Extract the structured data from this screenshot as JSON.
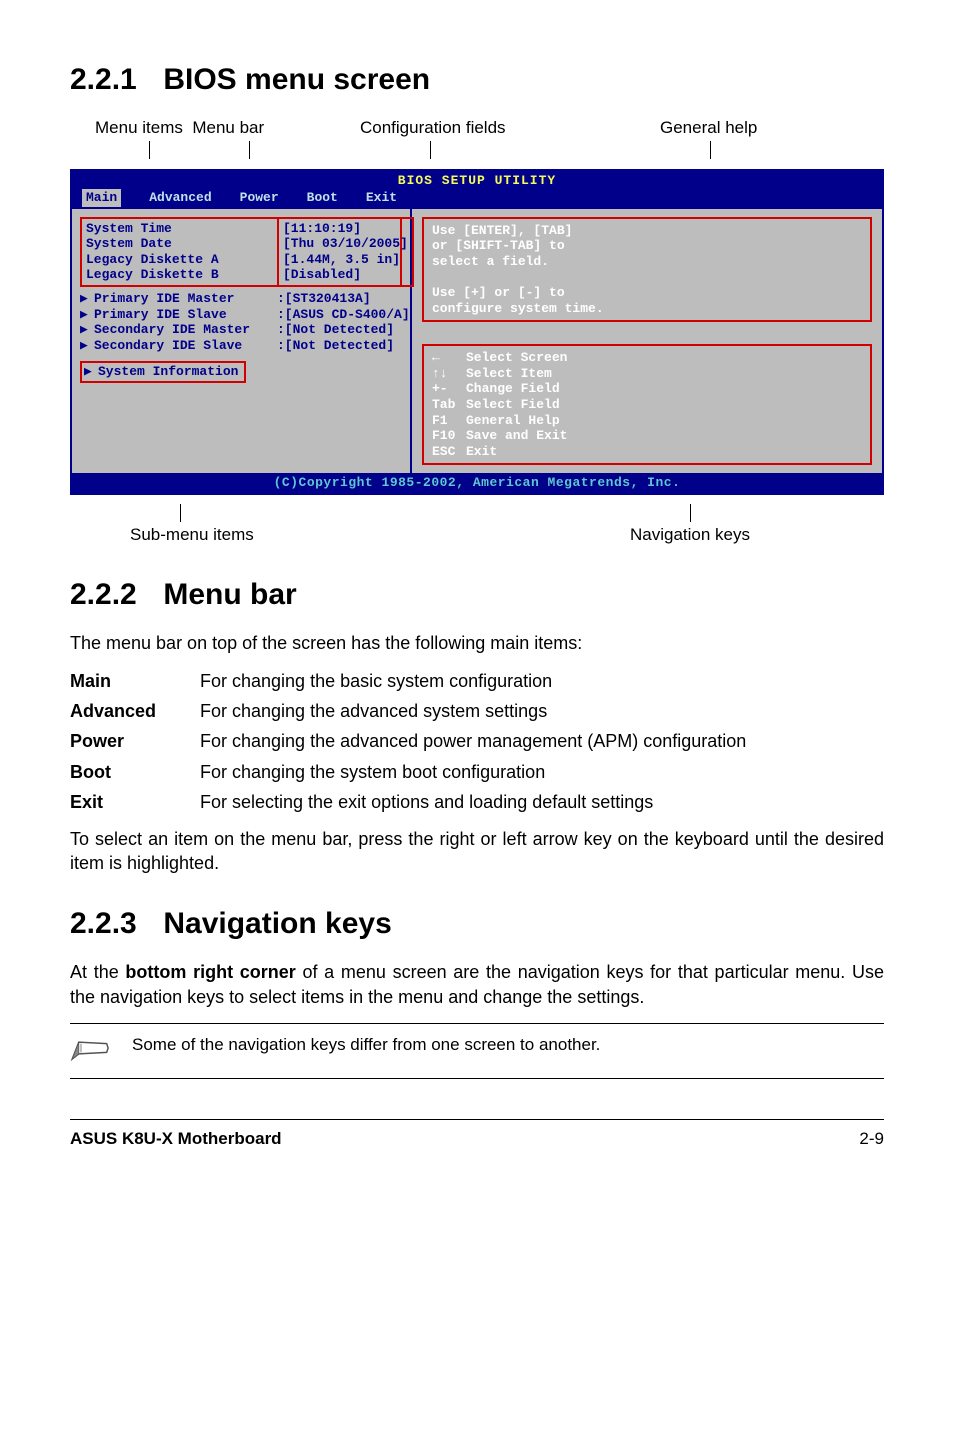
{
  "section1": {
    "num": "2.2.1",
    "title": "BIOS menu screen"
  },
  "labels_top": {
    "menu_items": "Menu items",
    "menu_bar": "Menu bar",
    "config_fields": "Configuration fields",
    "general_help": "General help"
  },
  "bios": {
    "title": "BIOS SETUP UTILITY",
    "tabs": {
      "main": "Main",
      "advanced": "Advanced",
      "power": "Power",
      "boot": "Boot",
      "exit": "Exit"
    },
    "left_group1": {
      "r1": "System Time",
      "r2": "System Date",
      "r3": "Legacy Diskette A",
      "r4": "Legacy Diskette B"
    },
    "left_group2": {
      "r1": "Primary IDE Master",
      "r2": "Primary IDE Slave",
      "r3": "Secondary IDE Master",
      "r4": "Secondary IDE Slave"
    },
    "left_group3": {
      "r1": "System Information"
    },
    "cfg_group1": {
      "r1": "[11:10:19]",
      "r2": "[Thu 03/10/2005]",
      "r3": "[1.44M, 3.5 in]",
      "r4": "[Disabled]"
    },
    "cfg_group2": {
      "r1": ":[ST320413A]",
      "r2": ":[ASUS CD-S400/A]",
      "r3": ":[Not Detected]",
      "r4": ":[Not Detected]"
    },
    "help": {
      "l1": "Use [ENTER], [TAB]",
      "l2": "or [SHIFT-TAB] to",
      "l3": "select a field.",
      "l4": "",
      "l5": "Use [+] or [-] to",
      "l6": "configure system time."
    },
    "nav": {
      "r1s": "←",
      "r1t": "Select Screen",
      "r2s": "↑↓",
      "r2t": "Select Item",
      "r3s": "+-",
      "r3t": "Change Field",
      "r4s": "Tab",
      "r4t": "Select Field",
      "r5s": "F1",
      "r5t": "General Help",
      "r6s": "F10",
      "r6t": "Save and Exit",
      "r7s": "ESC",
      "r7t": "Exit"
    },
    "footer": "(C)Copyright 1985-2002, American Megatrends, Inc."
  },
  "labels_bottom": {
    "submenu": "Sub-menu items",
    "navkeys": "Navigation keys"
  },
  "section2": {
    "num": "2.2.2",
    "title": "Menu bar",
    "intro": "The menu bar on top of the screen has the following main items:",
    "rows": {
      "main": {
        "term": "Main",
        "desc": "For changing the basic system configuration"
      },
      "advanced": {
        "term": "Advanced",
        "desc": "For changing the advanced system settings"
      },
      "power": {
        "term": "Power",
        "desc": "For changing the advanced power management (APM) configuration"
      },
      "boot": {
        "term": "Boot",
        "desc": "For changing the system boot configuration"
      },
      "exit": {
        "term": "Exit",
        "desc": "For selecting the exit options and loading default settings"
      }
    },
    "outro": "To select an item on the menu bar, press the right or left arrow key on the keyboard until the desired item is highlighted."
  },
  "section3": {
    "num": "2.2.3",
    "title": "Navigation keys",
    "para_pre": "At the ",
    "para_bold": "bottom right corner",
    "para_post": " of a menu screen are the navigation keys for that particular menu. Use the navigation keys to select items in the menu and change the settings."
  },
  "note": "Some of the navigation keys differ from one screen to another.",
  "footer": {
    "left": "ASUS K8U-X Motherboard",
    "right": "2-9"
  }
}
